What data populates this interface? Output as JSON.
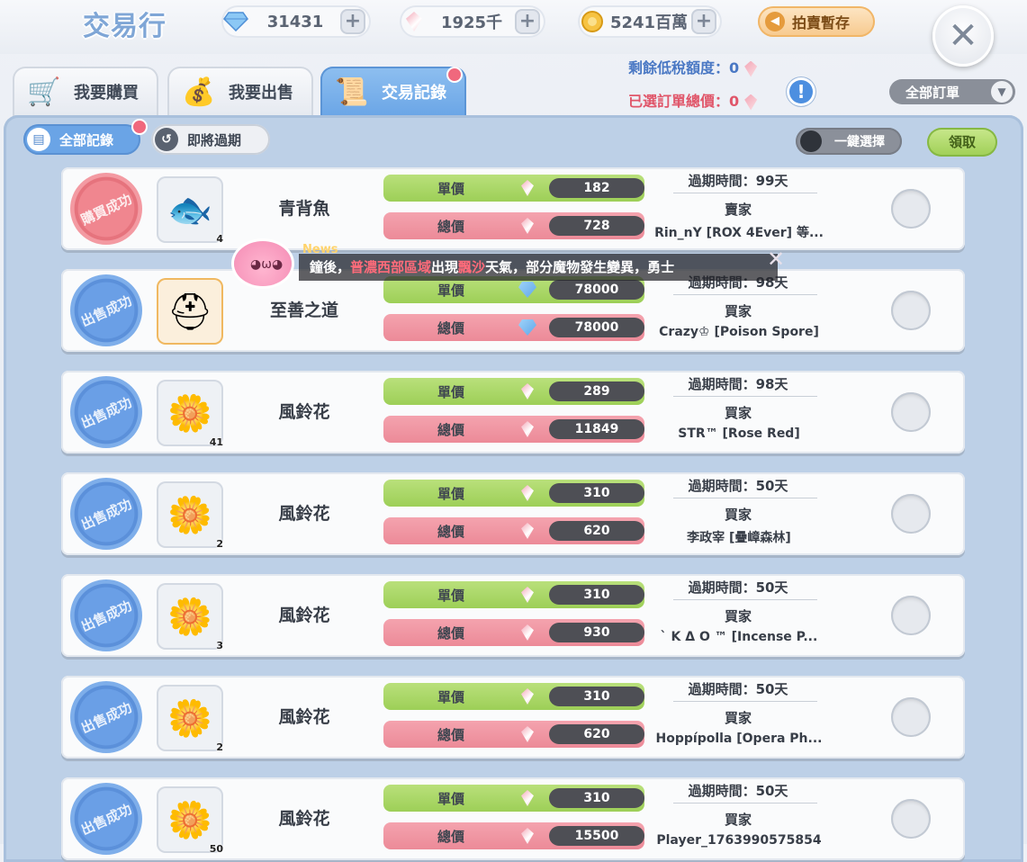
{
  "header": {
    "title": "交易行",
    "currencies": [
      {
        "icon": "diamond-icon",
        "value": "31431"
      },
      {
        "icon": "crystal-icon",
        "value": "1925千"
      },
      {
        "icon": "zeny-coin-icon",
        "value": "5241百萬"
      }
    ],
    "auction_button": "拍賣暫存"
  },
  "tabs": [
    {
      "label": "我要購買",
      "icon": "cart-icon"
    },
    {
      "label": "我要出售",
      "icon": "money-bag-icon"
    },
    {
      "label": "交易記錄",
      "icon": "scroll-icon",
      "active": true
    }
  ],
  "summary": {
    "low_tax_label": "剩餘低稅額度：",
    "low_tax_value": "0",
    "selected_total_label": "已選訂單總價：",
    "selected_total_value": "0"
  },
  "order_filter": {
    "label": "全部訂單"
  },
  "subtabs": [
    {
      "label": "全部記錄",
      "active": true
    },
    {
      "label": "即將過期"
    }
  ],
  "toggle_label": "一鍵選擇",
  "claim_label": "領取",
  "news": {
    "tag": "News",
    "text_1": "鐘後，",
    "text_red_1": "普濃西部區域",
    "text_2": "出現",
    "text_red_2": "飄沙",
    "text_3": "天氣，部分魔物發生變異，勇士"
  },
  "labels": {
    "unit_price": "單價",
    "total_price": "總價"
  },
  "records": [
    {
      "status": "購買成功",
      "item": "青背魚",
      "item_icon": "fish-icon",
      "qty": "4",
      "unit": "182",
      "total": "728",
      "currency": "crystal",
      "expire": "過期時間：99天",
      "role": "賣家",
      "party": "Rin_nY [ROX 4Ever] 等..."
    },
    {
      "status": "出售成功",
      "item": "至善之道",
      "item_icon": "helmet-icon",
      "qty": "",
      "unit": "78000",
      "total": "78000",
      "currency": "diamond",
      "expire": "過期時間：98天",
      "role": "買家",
      "party": "Crazy♔ [Poison Spore]"
    },
    {
      "status": "出售成功",
      "item": "風鈴花",
      "item_icon": "bell-flower-icon",
      "qty": "41",
      "unit": "289",
      "total": "11849",
      "currency": "crystal",
      "expire": "過期時間：98天",
      "role": "買家",
      "party": "STR™ [Rose Red]"
    },
    {
      "status": "出售成功",
      "item": "風鈴花",
      "item_icon": "bell-flower-icon",
      "qty": "2",
      "unit": "310",
      "total": "620",
      "currency": "crystal",
      "expire": "過期時間：50天",
      "role": "買家",
      "party": "李政宰 [疊嶂森林]"
    },
    {
      "status": "出售成功",
      "item": "風鈴花",
      "item_icon": "bell-flower-icon",
      "qty": "3",
      "unit": "310",
      "total": "930",
      "currency": "crystal",
      "expire": "過期時間：50天",
      "role": "買家",
      "party": "` K Δ O ™ [Incense P..."
    },
    {
      "status": "出售成功",
      "item": "風鈴花",
      "item_icon": "bell-flower-icon",
      "qty": "2",
      "unit": "310",
      "total": "620",
      "currency": "crystal",
      "expire": "過期時間：50天",
      "role": "買家",
      "party": "Hoppípolla [Opera Ph..."
    },
    {
      "status": "出售成功",
      "item": "風鈴花",
      "item_icon": "bell-flower-icon",
      "qty": "50",
      "unit": "310",
      "total": "15500",
      "currency": "crystal",
      "expire": "過期時間：50天",
      "role": "買家",
      "party": "Player_1763990575854"
    }
  ]
}
